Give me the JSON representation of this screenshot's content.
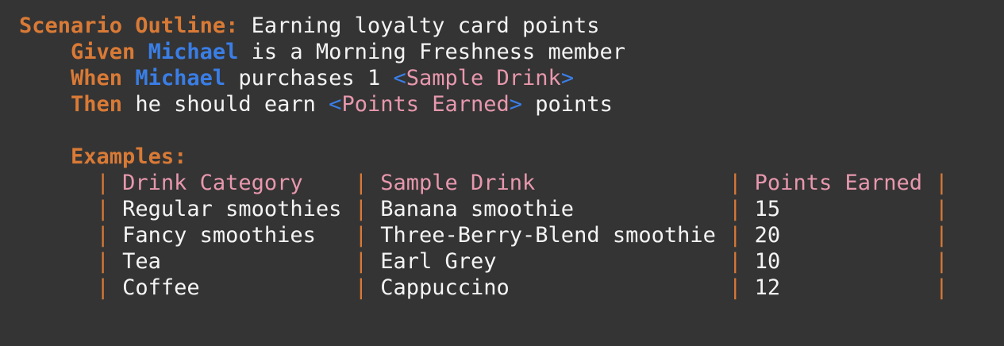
{
  "scenario": {
    "keyword": "Scenario Outline:",
    "title": "Earning loyalty card points"
  },
  "steps": [
    {
      "keyword": "Given",
      "actor": "Michael",
      "text_before": "is a Morning Freshness member"
    },
    {
      "keyword": "When",
      "actor": "Michael",
      "text_before": "purchases 1",
      "param_open": "<",
      "param": "Sample Drink",
      "param_close": ">"
    },
    {
      "keyword": "Then",
      "text_before": "he should earn",
      "param_open": "<",
      "param": "Points Earned",
      "param_close": ">",
      "text_after": "points"
    }
  ],
  "examples": {
    "keyword": "Examples:",
    "pipe": "|",
    "headers": [
      "Drink Category",
      "Sample Drink",
      "Points Earned"
    ],
    "rows": [
      [
        "Regular smoothies",
        "Banana smoothie",
        "15"
      ],
      [
        "Fancy smoothies",
        "Three-Berry-Blend smoothie",
        "20"
      ],
      [
        "Tea",
        "Earl Grey",
        "10"
      ],
      [
        "Coffee",
        "Cappuccino",
        "12"
      ]
    ]
  },
  "colors": {
    "background": "#343434",
    "keyword": "#d97a36",
    "actor": "#3a7ee6",
    "parameter": "#e898ae",
    "text": "#f4f4f4"
  }
}
